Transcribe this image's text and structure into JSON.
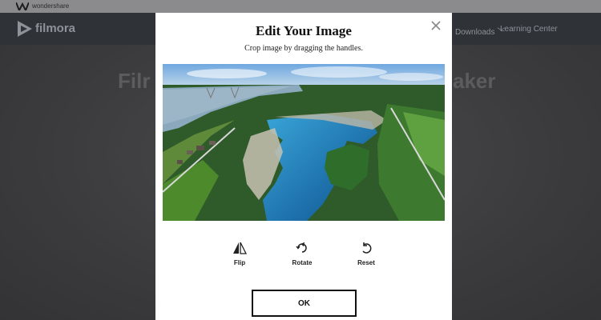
{
  "background": {
    "topbar": {
      "brand": "wondershare"
    },
    "nav": {
      "brand": "filmora",
      "downloads": "Downloads",
      "learning_center": "Learning Center"
    },
    "hero": {
      "left_fragment": "Filr",
      "right_fragment": "aker"
    }
  },
  "modal": {
    "title": "Edit Your Image",
    "subtitle": "Crop image by dragging the handles.",
    "tools": [
      {
        "label": "Flip",
        "icon": "flip-icon"
      },
      {
        "label": "Rotate",
        "icon": "rotate-icon"
      },
      {
        "label": "Reset",
        "icon": "reset-icon"
      }
    ],
    "ok_label": "OK",
    "close_icon": "close-icon"
  },
  "colors": {
    "overlay": "#3d3d3f",
    "modal": "#ffffff",
    "nav": "#2f3237"
  }
}
